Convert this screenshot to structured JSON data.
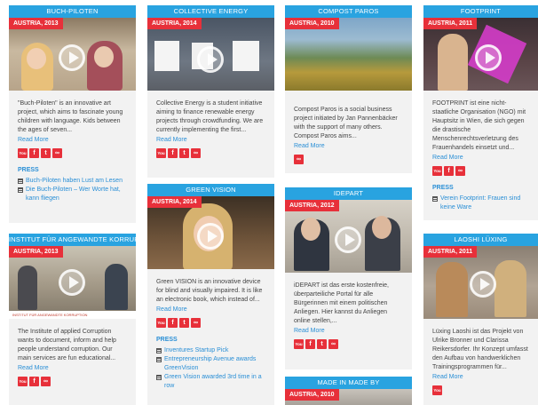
{
  "cards": [
    {
      "title": "BUCH-PILOTEN",
      "badge": "AUSTRIA, 2013",
      "description": "\"Buch-Piloten\" is an innovative art project, which aims to fascinate young children with language. Kids between the ages of seven...",
      "read_more": "Read More",
      "press_label": "PRESS",
      "press_links": [
        "Buch-Piloten haben Lust am Lesen",
        "Die Buch-Piloten – Wer Worte hat, kann fliegen"
      ]
    },
    {
      "title": "COLLECTIVE ENERGY",
      "badge": "AUSTRIA, 2014",
      "description": "Collective Energy is a student initiative aiming to finance renewable energy projects through crowdfunding. We are currently implementing the first...",
      "read_more": "Read More"
    },
    {
      "title": "COMPOST PAROS",
      "badge": "AUSTRIA, 2010",
      "description": "Compost Paros is a social business project initiated by Jan Pannenbäcker with the support of many others. Compost Paros aims...",
      "read_more": "Read More"
    },
    {
      "title": "FOOTPRINT",
      "badge": "AUSTRIA, 2011",
      "description": "FOOTPRINT ist eine nicht-staatliche Organisation (NGO) mit Hauptsitz in Wien, die sich gegen die drastische Menschenrechtsverletzung des Frauenhandels einsetzt und...",
      "read_more": "Read More",
      "press_label": "PRESS",
      "press_links": [
        "Verein Footprint: Frauen sind keine Ware"
      ]
    },
    {
      "title": "INSTITUT FÜR ANGEWANDTE KORRUPTION",
      "badge": "AUSTRIA, 2013",
      "thumb_caption": "INSTITUT FÜR ANGEWANDTE KORRUPTION",
      "description": "The Institute of applied Corruption wants to document, inform and help people understand corruption. Our main services are fun educational...",
      "read_more": "Read More"
    },
    {
      "title": "GREEN VISION",
      "badge": "AUSTRIA, 2014",
      "description": "Green VISION is an innovative device for blind and visually impaired. It is like an electronic book, which instead of...",
      "read_more": "Read More",
      "press_label": "PRESS",
      "press_links": [
        "Inventures Startup Pick",
        "Entrepreneurship Avenue awards GreenVision",
        "Green Vision awarded 3rd time in a row"
      ]
    },
    {
      "title": "IDEPART",
      "badge": "AUSTRIA, 2012",
      "description": "iDEPART ist das erste kostenfreie, überparteiliche Portal für alle Bürgerinnen mit einem politischen Anliegen. Hier kannst du Anliegen online stellen,...",
      "read_more": "Read More"
    },
    {
      "title": "LAOSHI LÜXING",
      "badge": "AUSTRIA, 2011",
      "description": "Lüxing Laoshi ist das Projekt von Ulrike Bronner und Clarissa Reikersdorfer. Ihr Konzept umfasst den Aufbau von handwerklichen Trainingsprogrammen für...",
      "read_more": "Read More"
    },
    {
      "title": "MADE IN MADE BY",
      "badge": "AUSTRIA, 2010"
    }
  ],
  "icons": {
    "youtube": "You",
    "facebook": "f",
    "twitter": "t",
    "link": "∞"
  },
  "colors": {
    "accent": "#29a3e0",
    "badge": "#e7303a",
    "card_bg": "#f2f2f2",
    "link": "#2a8fd6"
  }
}
